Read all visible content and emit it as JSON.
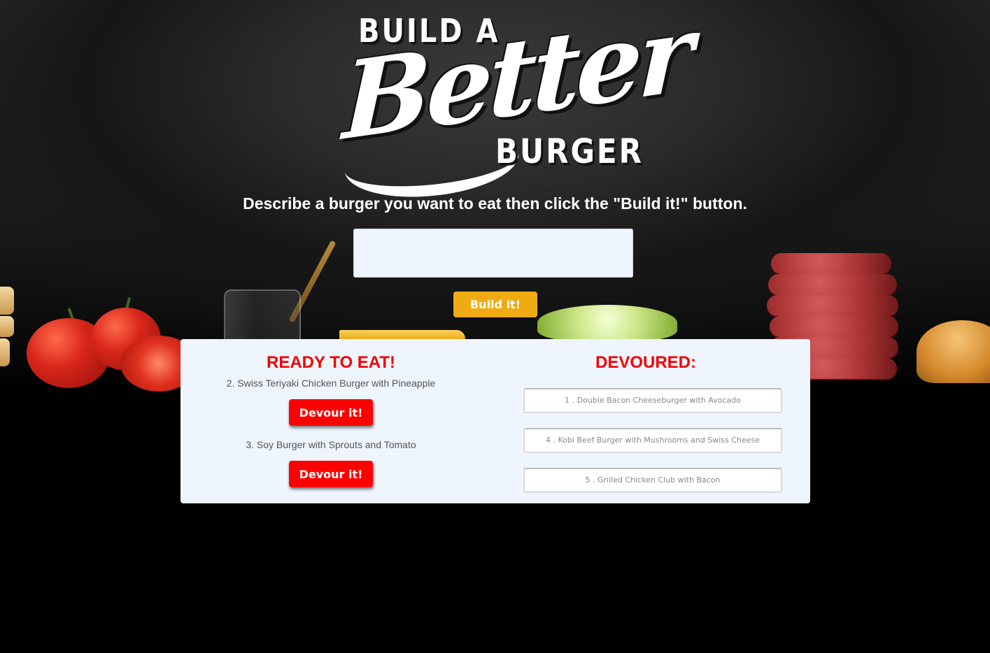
{
  "logo": {
    "top_text": "BUILD A",
    "script_text": "Better",
    "bottom_text": "BURGER"
  },
  "instructions": "Describe a burger you want to eat then click the \"Build it!\" button.",
  "burger_input": {
    "value": "",
    "placeholder": ""
  },
  "build_button_label": "Build it!",
  "ready": {
    "heading": "READY TO EAT!",
    "items": [
      {
        "label": "2. Swiss Teriyaki Chicken Burger with Pineapple",
        "button_label": "Devour it!"
      },
      {
        "label": "3. Soy Burger with Sprouts and Tomato",
        "button_label": "Devour it!"
      }
    ]
  },
  "devoured": {
    "heading": "DEVOURED:",
    "items": [
      "1 . Double Bacon Cheeseburger with Avocado",
      "4 . Kobi Beef Burger with Mushrooms and Swiss Cheese",
      "5 . Grilled Chicken Club with Bacon"
    ]
  },
  "colors": {
    "accent_red": "#ff0000",
    "heading_red": "#f40000",
    "build_yellow": "#efac12",
    "panel_bg": "#eef5fd"
  }
}
